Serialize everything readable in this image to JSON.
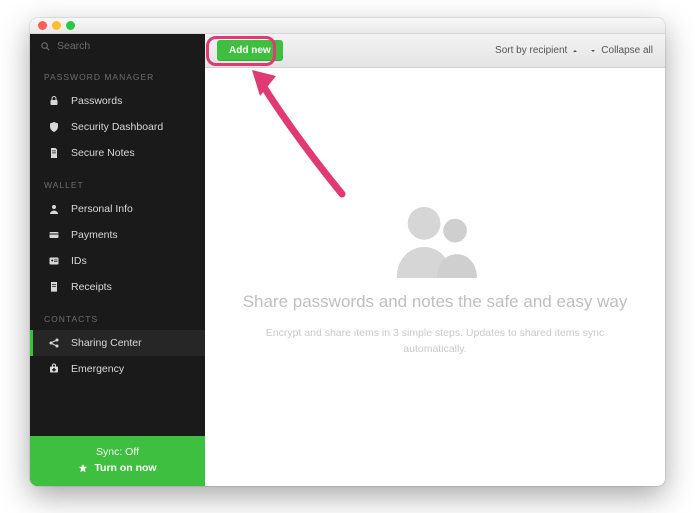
{
  "search": {
    "placeholder": "Search"
  },
  "sections": {
    "pm": {
      "title": "PASSWORD MANAGER"
    },
    "wallet": {
      "title": "WALLET"
    },
    "contacts": {
      "title": "CONTACTS"
    }
  },
  "nav": {
    "passwords": "Passwords",
    "security_dashboard": "Security Dashboard",
    "secure_notes": "Secure Notes",
    "personal_info": "Personal Info",
    "payments": "Payments",
    "ids": "IDs",
    "receipts": "Receipts",
    "sharing_center": "Sharing Center",
    "emergency": "Emergency"
  },
  "sync": {
    "status": "Sync: Off",
    "cta": "Turn on now"
  },
  "toolbar": {
    "add_new": "Add new",
    "sort": "Sort by recipient",
    "collapse": "Collapse all"
  },
  "empty": {
    "heading": "Share passwords and notes the safe and easy way",
    "sub": "Encrypt and share items in 3 simple steps. Updates to shared items sync automatically."
  }
}
